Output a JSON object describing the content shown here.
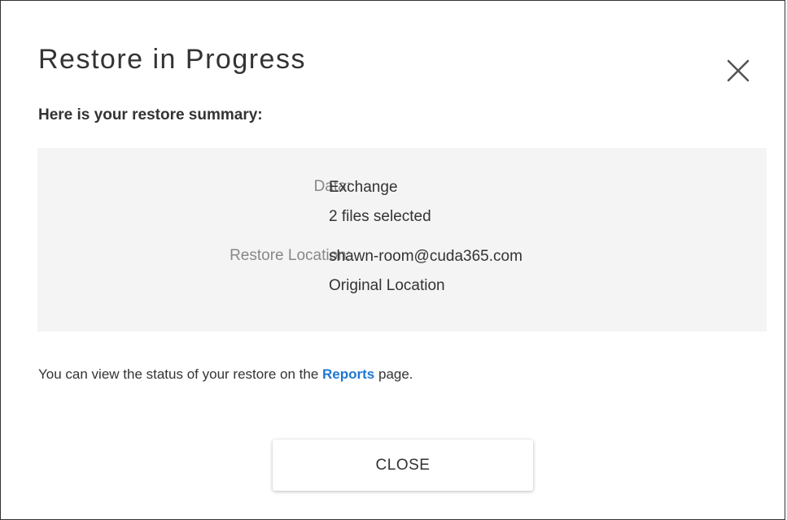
{
  "dialog": {
    "title": "Restore in Progress",
    "close_icon": "close-icon",
    "subtitle": "Here is your restore summary:",
    "summary": {
      "data_label": "Data:",
      "data_values": [
        "Exchange",
        "2 files selected"
      ],
      "location_label": "Restore Location:",
      "location_values": [
        "shawn-room@cuda365.com",
        "Original Location"
      ]
    },
    "info": {
      "before": "You can view the status of your restore on the ",
      "link": "Reports",
      "after": " page."
    },
    "close_button_label": "CLOSE"
  },
  "colors": {
    "link": "#1e78d2",
    "summary_bg": "#f4f4f4",
    "label_gray": "#888888",
    "text": "#333333"
  }
}
